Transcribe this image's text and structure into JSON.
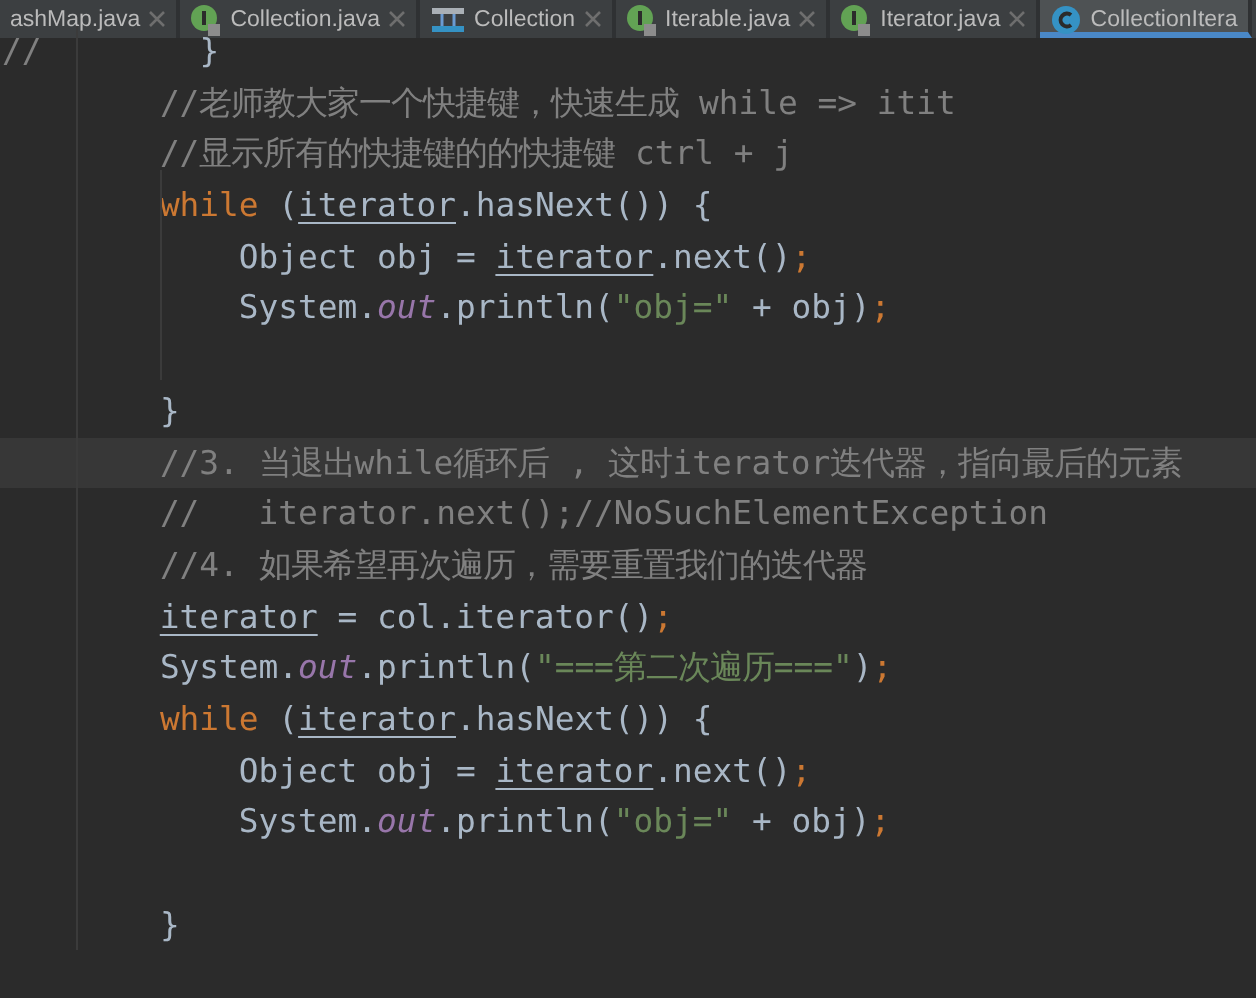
{
  "tabs": [
    {
      "label": "ashMap.java",
      "kind": "none",
      "selected": false
    },
    {
      "label": "Collection.java",
      "kind": "interface",
      "selected": false
    },
    {
      "label": "Collection",
      "kind": "diagram",
      "selected": false
    },
    {
      "label": "Iterable.java",
      "kind": "interface",
      "selected": false
    },
    {
      "label": "Iterator.java",
      "kind": "interface",
      "selected": false
    },
    {
      "label": "CollectionItera",
      "kind": "class",
      "selected": true
    }
  ],
  "lines": [
    {
      "current": false,
      "tokens": [
        {
          "kind": "comment",
          "text": "//"
        },
        {
          "kind": "plain",
          "text": "        }"
        }
      ]
    },
    {
      "current": false,
      "tokens": [
        {
          "kind": "comment",
          "text": "        //老师教大家一个快捷键，快速生成 while => itit"
        }
      ]
    },
    {
      "current": false,
      "tokens": [
        {
          "kind": "comment",
          "text": "        //显示所有的快捷键的的快捷键 ctrl + j"
        }
      ]
    },
    {
      "current": false,
      "tokens": [
        {
          "kind": "keyword",
          "text": "        while"
        },
        {
          "kind": "plain",
          "text": " ("
        },
        {
          "kind": "underline",
          "text": "iterator"
        },
        {
          "kind": "plain",
          "text": ".hasNext()) {"
        }
      ]
    },
    {
      "current": false,
      "tokens": [
        {
          "kind": "plain",
          "text": "            Object obj = "
        },
        {
          "kind": "underline",
          "text": "iterator"
        },
        {
          "kind": "plain",
          "text": ".next()"
        },
        {
          "kind": "keyword",
          "text": ";"
        }
      ]
    },
    {
      "current": false,
      "tokens": [
        {
          "kind": "plain",
          "text": "            System."
        },
        {
          "kind": "field",
          "text": "out"
        },
        {
          "kind": "plain",
          "text": ".println("
        },
        {
          "kind": "string",
          "text": "\"obj=\""
        },
        {
          "kind": "plain",
          "text": " + obj)"
        },
        {
          "kind": "keyword",
          "text": ";"
        }
      ]
    },
    {
      "current": false
    },
    {
      "current": false,
      "tokens": [
        {
          "kind": "plain",
          "text": "        }"
        }
      ]
    },
    {
      "current": true,
      "tokens": [
        {
          "kind": "comment",
          "text": "        //3. 当退出while循环后 , 这时iterator迭代器，指向最后的元素"
        }
      ]
    },
    {
      "current": false,
      "tokens": [
        {
          "kind": "comment",
          "text": "        //   iterator.next();//NoSuchElementException"
        }
      ]
    },
    {
      "current": false,
      "tokens": [
        {
          "kind": "comment",
          "text": "        //4. 如果希望再次遍历，需要重置我们的迭代器"
        }
      ]
    },
    {
      "current": false,
      "kind": "indented",
      "tokens": [
        {
          "kind": "underline",
          "text": "iterator"
        },
        {
          "kind": "plain",
          "text": " = col.iterator()"
        },
        {
          "kind": "keyword",
          "text": ";"
        }
      ]
    },
    {
      "current": false,
      "tokens": [
        {
          "kind": "plain",
          "text": "        System."
        },
        {
          "kind": "field",
          "text": "out"
        },
        {
          "kind": "plain",
          "text": ".println("
        },
        {
          "kind": "string",
          "text": "\"===第二次遍历===\""
        },
        {
          "kind": "plain",
          "text": ")"
        },
        {
          "kind": "keyword",
          "text": ";"
        }
      ]
    },
    {
      "current": false,
      "tokens": [
        {
          "kind": "keyword",
          "text": "        while"
        },
        {
          "kind": "plain",
          "text": " ("
        },
        {
          "kind": "underline",
          "text": "iterator"
        },
        {
          "kind": "plain",
          "text": ".hasNext()) {"
        }
      ]
    },
    {
      "current": false,
      "tokens": [
        {
          "kind": "plain",
          "text": "            Object obj = "
        },
        {
          "kind": "underline",
          "text": "iterator"
        },
        {
          "kind": "plain",
          "text": ".next()"
        },
        {
          "kind": "keyword",
          "text": ";"
        }
      ]
    },
    {
      "current": false,
      "tokens": [
        {
          "kind": "plain",
          "text": "            System."
        },
        {
          "kind": "field",
          "text": "out"
        },
        {
          "kind": "plain",
          "text": ".println("
        },
        {
          "kind": "string",
          "text": "\"obj=\""
        },
        {
          "kind": "plain",
          "text": " + obj)"
        },
        {
          "kind": "keyword",
          "text": ";"
        }
      ]
    },
    {
      "current": false
    },
    {
      "current": false,
      "tokens": [
        {
          "kind": "plain",
          "text": "        }"
        }
      ]
    }
  ]
}
